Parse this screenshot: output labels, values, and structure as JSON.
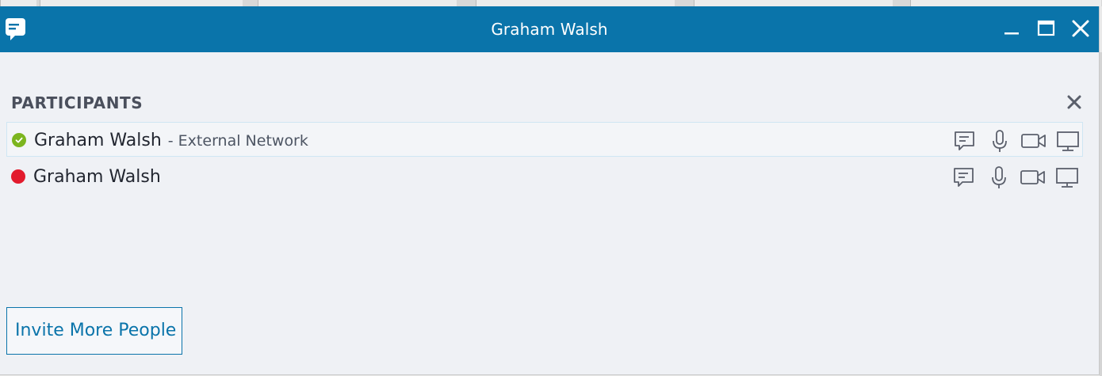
{
  "window": {
    "title": "Graham Walsh",
    "accent_color": "#0a74aa",
    "icons": {
      "app": "chat-bubble-icon",
      "minimize": "minimize-icon",
      "maximize": "maximize-icon",
      "close": "close-icon"
    }
  },
  "participants_panel": {
    "heading": "PARTICIPANTS",
    "close_icon": "close-icon",
    "participants": [
      {
        "name": "Graham Walsh",
        "network": "- External Network",
        "presence": "available",
        "presence_color": "#7cb51f",
        "selected": true,
        "actions": [
          "im-icon",
          "microphone-icon",
          "video-icon",
          "screen-share-icon"
        ]
      },
      {
        "name": "Graham Walsh",
        "network": "",
        "presence": "busy",
        "presence_color": "#e21b2d",
        "selected": false,
        "actions": [
          "im-icon",
          "microphone-icon",
          "video-icon",
          "screen-share-icon"
        ]
      }
    ]
  },
  "footer": {
    "invite_button_label": "Invite More People"
  }
}
